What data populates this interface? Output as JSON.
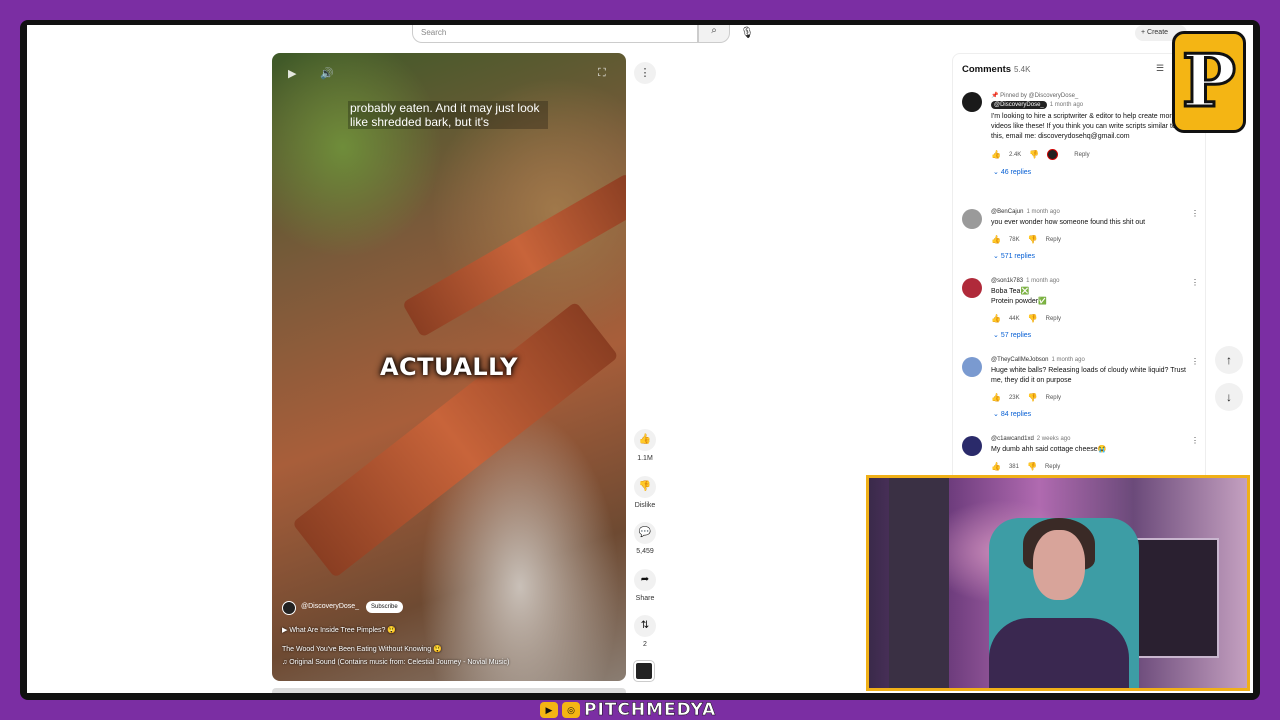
{
  "search": {
    "placeholder": "Search"
  },
  "header": {
    "create_label": "+ Create"
  },
  "video": {
    "caption_top": "probably eaten. And it may just look like shredded bark, but it's",
    "caption_big": "ACTUALLY",
    "channel": "@DiscoveryDose_",
    "subscribe_label": "Subscribe",
    "related": "▶  What Are Inside Tree Pimples? 😲",
    "title": "The Wood You've Been Eating Without Knowing 😲",
    "sound": "♫  Original Sound (Contains music from: Celestial Journey - Novial Music)"
  },
  "actions": {
    "likes": "1.1M",
    "dislike": "Dislike",
    "comments": "5,459",
    "share": "Share",
    "remix": "2"
  },
  "comments": {
    "title": "Comments",
    "count": "5.4K",
    "items": [
      {
        "pinned": "📌 Pinned by @DiscoveryDose_",
        "author": "@DiscoveryDose_",
        "age": "1 month ago",
        "text": "I'm looking to hire a scriptwriter & editor to help create more videos like these! If you think you can write scripts similar to this, email me: discoverydosehq@gmail.com",
        "likes": "2.4K",
        "reply": "Reply",
        "replies": "46 replies",
        "avatar_color": "#1a1a1a"
      },
      {
        "author": "@BenCajun",
        "age": "1 month ago",
        "text": "you ever wonder how someone found this shit out",
        "likes": "78K",
        "reply": "Reply",
        "replies": "571 replies",
        "avatar_color": "#9a9a9a"
      },
      {
        "author": "@son1k783",
        "age": "1 month ago",
        "text": "Boba Tea❎\nProtein powder✅",
        "likes": "44K",
        "reply": "Reply",
        "replies": "57 replies",
        "avatar_color": "#b02a3a"
      },
      {
        "author": "@TheyCallMeJobson",
        "age": "1 month ago",
        "text": "Huge white balls? Releasing loads of cloudy white liquid? Trust me, they did it on purpose",
        "likes": "23K",
        "reply": "Reply",
        "replies": "84 replies",
        "avatar_color": "#7a9ad0"
      },
      {
        "author": "@c1awcand1xd",
        "age": "2 weeks ago",
        "text": "My dumb ahh said cottage cheese😭",
        "likes": "381",
        "reply": "Reply",
        "avatar_color": "#2a2a6a"
      }
    ]
  },
  "overlay": {
    "logo_letter": "P",
    "brand": "PITCHMEDYA"
  }
}
